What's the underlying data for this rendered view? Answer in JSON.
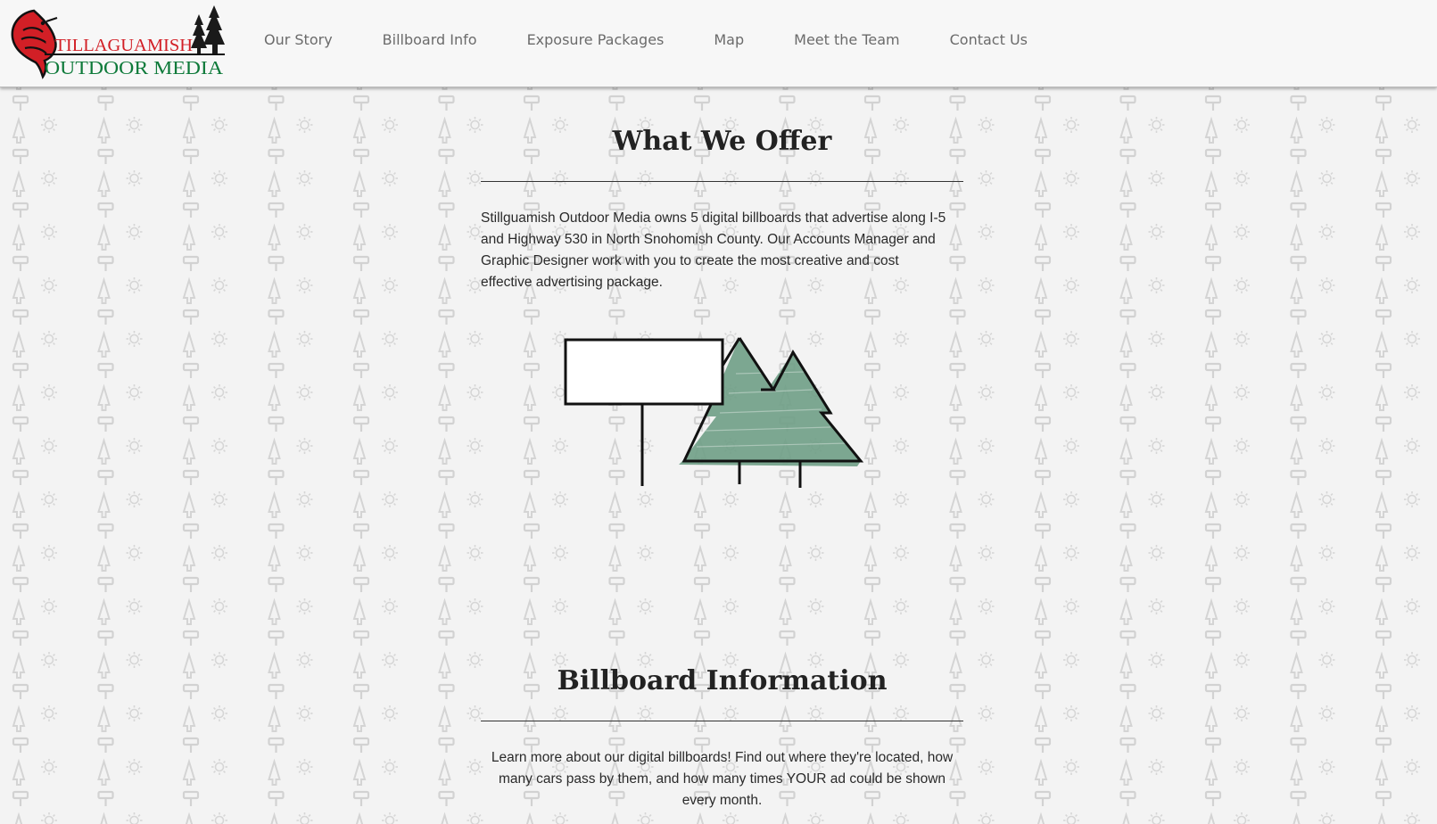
{
  "brand": {
    "line1": "STILLAGUAMISH",
    "line2": "OUTDOOR MEDIA",
    "colors": {
      "red": "#d21f26",
      "green": "#0e7a3a",
      "dark": "#1a1a1a"
    }
  },
  "nav": {
    "items": [
      {
        "label": "Our Story"
      },
      {
        "label": "Billboard Info"
      },
      {
        "label": "Exposure Packages"
      },
      {
        "label": "Map"
      },
      {
        "label": "Meet the Team"
      },
      {
        "label": "Contact Us"
      }
    ]
  },
  "sections": {
    "offer": {
      "title": "What We Offer",
      "body": "Stillguamish Outdoor Media owns 5 digital billboards that advertise along I-5 and Highway 530 in North Snohomish County. Our Accounts Manager and Graphic Designer work with you to create the most creative and cost effective advertising package."
    },
    "billboard": {
      "title": "Billboard Information",
      "body": "Learn more about our digital billboards! Find out where they're located, how many cars pass by them, and how many times YOUR ad could be shown every month."
    }
  },
  "theme": {
    "page_bg": "#f3f3f3",
    "header_bg": "#f7f7f7",
    "pattern_icon_color": "#d9d9d9",
    "tree_fill": "#6f9e86",
    "nav_text": "#6b6b6b"
  }
}
